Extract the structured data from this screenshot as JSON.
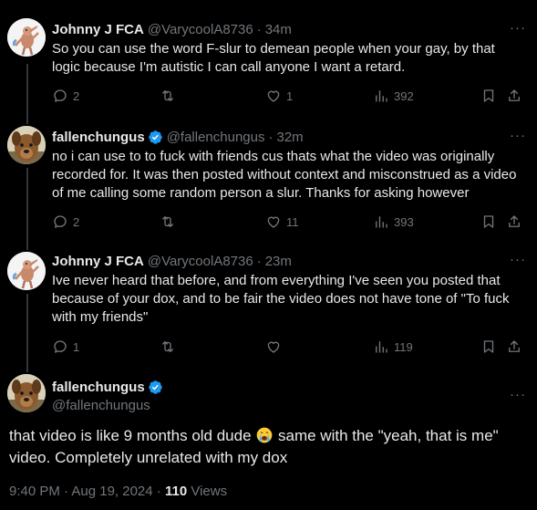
{
  "tweets": [
    {
      "name": "Johnny J FCA",
      "handle": "@VarycoolA8736",
      "dot": "·",
      "time": "34m",
      "more": "···",
      "verified": false,
      "avatar": "anteater-figure",
      "text": "So you can use the word F-slur to demean people when your gay, by that logic because I'm autistic I can call anyone I want a retard.",
      "replies": "2",
      "retweets": "",
      "likes": "1",
      "views": "392"
    },
    {
      "name": "fallenchungus",
      "handle": "@fallenchungus",
      "dot": "·",
      "time": "32m",
      "more": "···",
      "verified": true,
      "avatar": "dog-photo",
      "text": "no i can use to to fuck with friends cus thats what the video was originally recorded for. It was then posted without context and misconstrued as a video of me calling some random person a slur. Thanks for asking however",
      "replies": "2",
      "retweets": "",
      "likes": "11",
      "views": "393"
    },
    {
      "name": "Johnny J FCA",
      "handle": "@VarycoolA8736",
      "dot": "·",
      "time": "23m",
      "more": "···",
      "verified": false,
      "avatar": "anteater-figure",
      "text": "Ive never heard that before, and from everything I've seen you posted that because of your dox, and to be fair the video does not have tone of \"To fuck with my friends\"",
      "replies": "1",
      "retweets": "",
      "likes": "",
      "views": "119"
    }
  ],
  "main_tweet": {
    "name": "fallenchungus",
    "handle": "@fallenchungus",
    "verified": true,
    "more": "···",
    "text_before_emoji": "that video is like 9 months old dude ",
    "emoji": "crying-face-emoji",
    "text_after_emoji": " same with the \"yeah, that is me\" video. Completely unrelated with my dox",
    "time": "9:40 PM · Aug 19, 2024",
    "separator": " · ",
    "views_count": "110",
    "views_label": " Views"
  },
  "colors": {
    "background": "#000000",
    "text": "#e7e9ea",
    "muted": "#71767b",
    "verified": "#1d9bf0",
    "thread_line": "#333639"
  }
}
